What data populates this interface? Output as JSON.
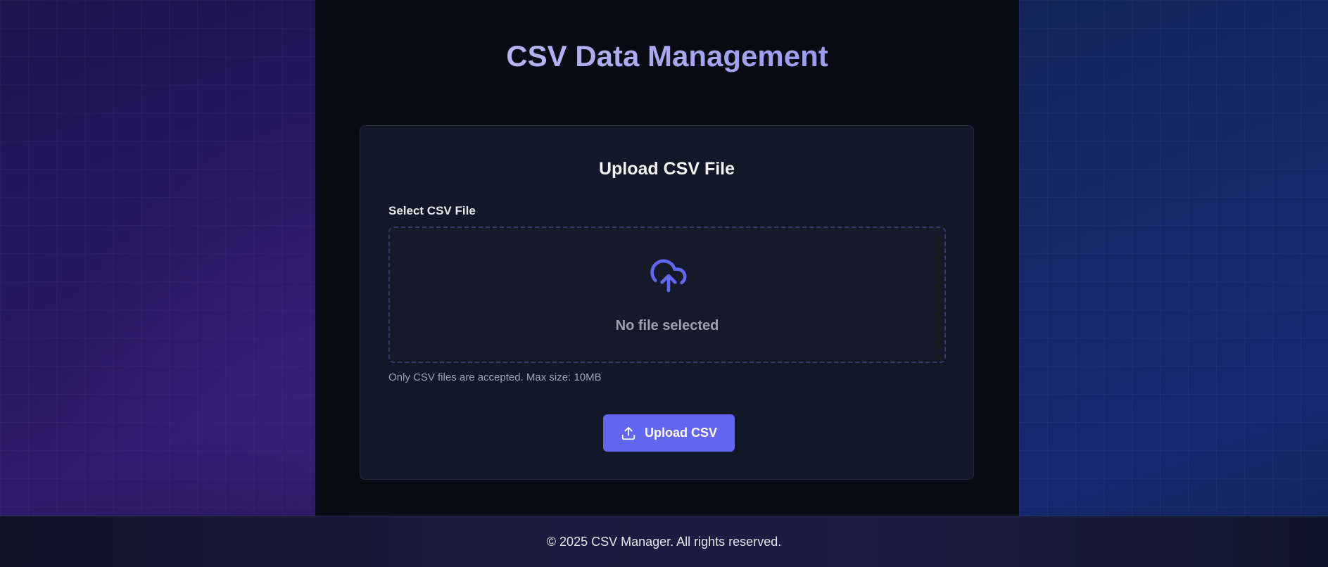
{
  "header": {
    "title": "CSV Data Management"
  },
  "upload_card": {
    "title": "Upload CSV File",
    "field_label": "Select CSV File",
    "dropzone_icon": "cloud-upload-icon",
    "dropzone_text": "No file selected",
    "help_text": "Only CSV files are accepted. Max size: 10MB",
    "button_icon": "upload-icon",
    "button_label": "Upload CSV"
  },
  "footer": {
    "copyright": "© 2025 CSV Manager. All rights reserved."
  },
  "colors": {
    "accent": "#6366f1",
    "card_background": "#111827",
    "page_background": "#070b14",
    "title_gradient_start": "#c2c3f5",
    "title_gradient_end": "#8b8cef"
  }
}
